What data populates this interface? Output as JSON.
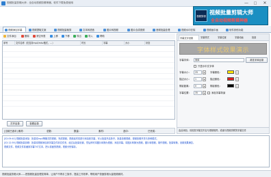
{
  "window": {
    "title": "视频批量剪辑大师 - 全自动视频剪辑神器，软件下载免费使用",
    "minimize_glyph": "—",
    "maximize_glyph": "□",
    "close_glyph": "✕"
  },
  "banner": {
    "logo_text": "视频剪辑",
    "line1": "视频批量剪辑大师",
    "line2": "全自动视频剪辑神器"
  },
  "tabs": [
    {
      "label": "视频添加字幕",
      "active": true
    },
    {
      "label": "视频提取文案",
      "active": false
    },
    {
      "label": "视频批量裁剪",
      "active": false
    },
    {
      "label": "文本转语音",
      "active": false
    },
    {
      "label": "图片转视频",
      "active": false
    },
    {
      "label": "图片合成视频",
      "active": false
    },
    {
      "label": "音频批量处理",
      "active": false
    },
    {
      "label": "视频水印去除",
      "active": false
    },
    {
      "label": "视频画中画",
      "active": false
    },
    {
      "label": "软件其他功能",
      "active": false
    }
  ],
  "toolbar": {
    "items": [
      {
        "label": "文件添加",
        "icon": "folder-add-icon",
        "color": "#f0b63a"
      },
      {
        "label": "删除",
        "icon": "delete-icon",
        "color": "#e04a3a"
      },
      {
        "label": "清空列表",
        "icon": "clear-list-icon",
        "color": "#e04a3a"
      },
      {
        "label": "上移",
        "icon": "arrow-up-icon",
        "color": "#3a8ee0"
      },
      {
        "label": "下移",
        "icon": "arrow-down-icon",
        "color": "#3a8ee0"
      },
      {
        "label": "导出",
        "icon": "export-icon",
        "color": "#3aae5a"
      },
      {
        "label": "导入",
        "icon": "import-icon",
        "color": "#3aae5a"
      },
      {
        "label": "帮助",
        "icon": "help-icon",
        "color": "#3a8ee0"
      }
    ]
  },
  "table": {
    "columns": [
      "序号",
      "文件名称（仅支持mp4/mkv格式，…）",
      "时长",
      "字幕",
      "大小",
      "状态"
    ]
  },
  "list_buttons": {
    "open_dir": "打开目录",
    "view_dir": "查看目录"
  },
  "status_line": {
    "label": "[当前已选中] 素材:",
    "items": [
      "总数：",
      "数量：",
      "素材：",
      "选中：",
      "已完成："
    ]
  },
  "right_panel": {
    "sub_tabs": [
      "字幕文字设置",
      "字幕样式",
      "字幕位置",
      "字幕动画",
      "批量"
    ],
    "preview_text": "字体样式效果演示",
    "font_label": "字幕字体：",
    "font_value": "宋体",
    "font_browse": "浏览字体目录",
    "bold_label": "只显示中文字体",
    "size_label": "字幕大小：",
    "size_value": "25",
    "font_color_label": "字幕颜色：",
    "stroke_label": "描边大小：",
    "stroke_value": "1",
    "stroke_color_label": "描边颜色：",
    "shadow_label": "阴影距离：",
    "shadow_value": "0",
    "shadow_color_label": "阴影颜色：",
    "pos_label": "字幕位置：",
    "pos_value": "35",
    "bg_label": "添加字幕背景",
    "hint": "由此添加，请检查字幕文件名与视频相同，或者与视频关联的字幕文件"
  },
  "colors": {
    "font": "#ffe600",
    "stroke": "#e02020",
    "shadow": "#000000"
  },
  "log": {
    "lines": [
      "[02:09:40] 视频批量添加：批量将mp4等格式的视频，完成视频，视频素材将进行添加到字幕，可以批量开启多开，批量剪辑视频，视频剪辑开关与多种模式。",
      "[02:12:59] 视频批量剪辑：批量将视频添加到字幕文件到文件夹，经过后批量设置，然后即可将图片转换为视频，添加字幕，将图片转换为视频，图片转视频，制作视频。批量转换，设置效果满意。",
      "视频文件，视频文件前缀到字幕TXT文本，把以前面的视频，视频分别保存。"
    ]
  },
  "footer": {
    "text": "视频批量剪辑大师——把视频批量处理变简单，让用户不再手工操作，提高工作效率，帮助用户快速剪辑大量视频素材。"
  }
}
